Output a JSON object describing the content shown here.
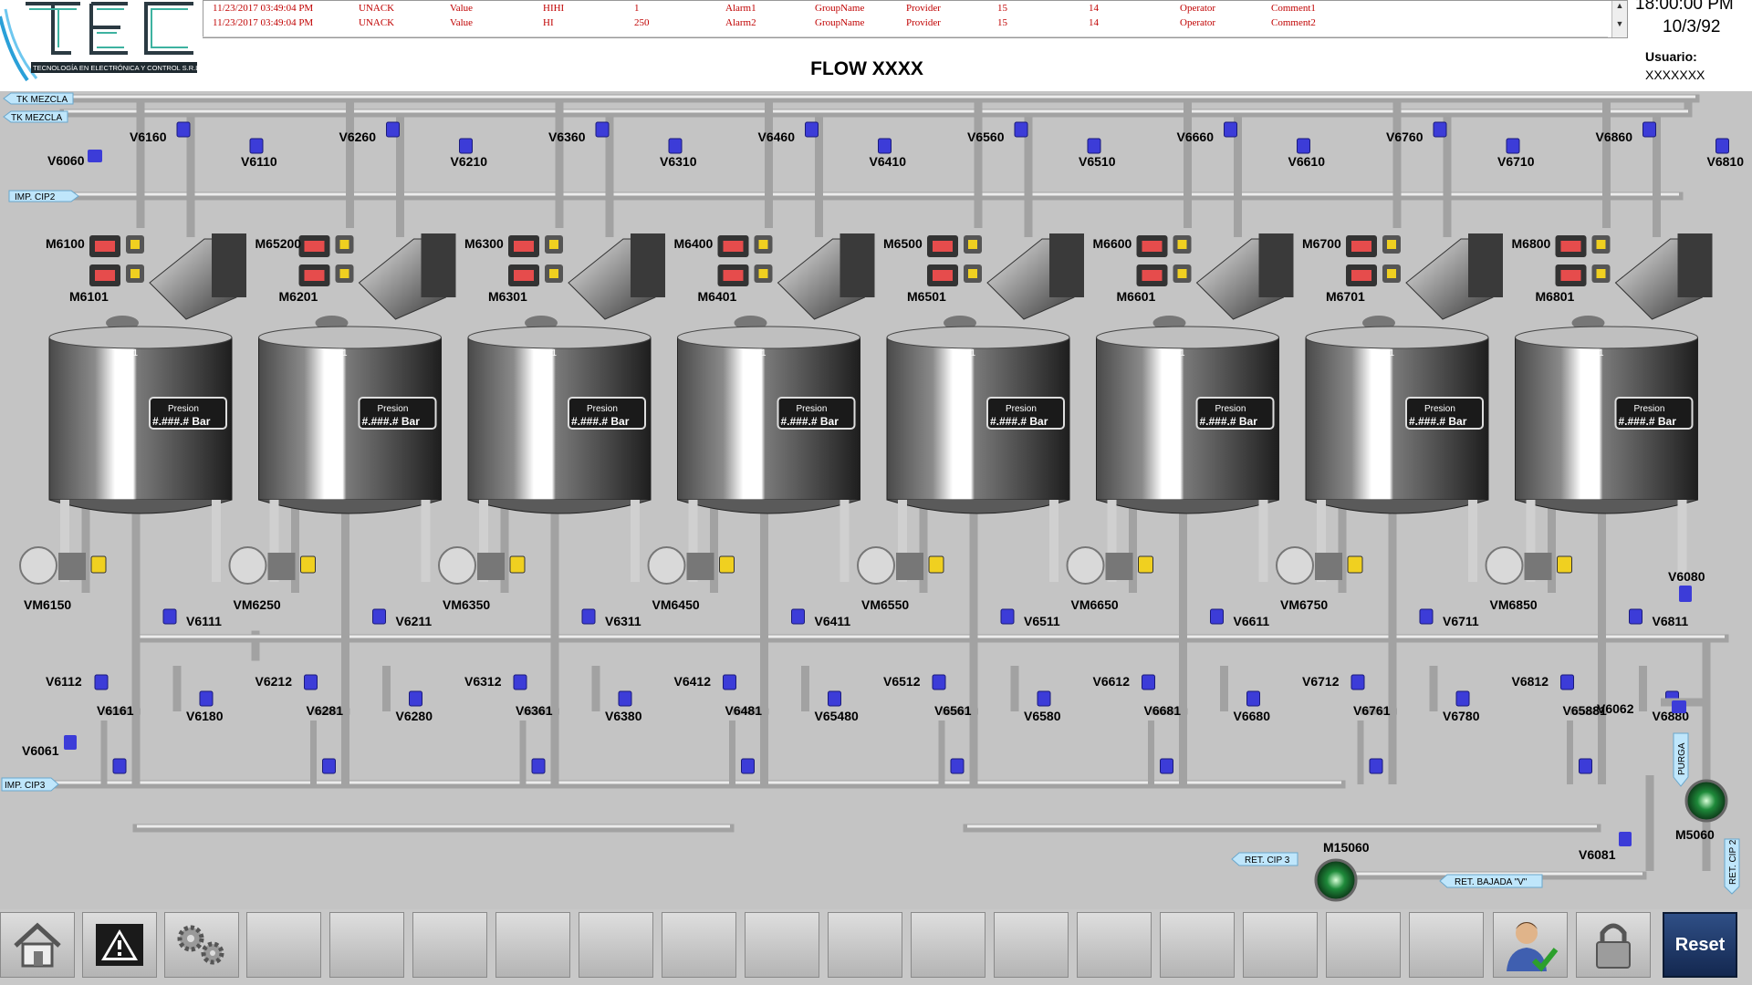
{
  "logo": {
    "text": "TEC",
    "tagline": "TECNOLOGÍA EN ELECTRÓNICA Y CONTROL S.R.L"
  },
  "alarms": [
    {
      "time": "11/23/2017 03:49:04 PM",
      "state": "UNACK",
      "type": "Value",
      "level": "HIHI",
      "value": "1",
      "name": "Alarm1",
      "group": "GroupName",
      "provider": "Provider",
      "p1": "15",
      "p2": "14",
      "operator": "Operator",
      "comment": "Comment1"
    },
    {
      "time": "11/23/2017 03:49:04 PM",
      "state": "UNACK",
      "type": "Value",
      "level": "HI",
      "value": "250",
      "name": "Alarm2",
      "group": "GroupName",
      "provider": "Provider",
      "p1": "15",
      "p2": "14",
      "operator": "Operator",
      "comment": "Comment2"
    }
  ],
  "title": "FLOW XXXX",
  "clock": {
    "time": "18:00:00 PM",
    "date": "10/3/92"
  },
  "user": {
    "label": "Usuario:",
    "value": "XXXXXXX"
  },
  "lines": {
    "tk_mezcla_1": "TK MEZCLA",
    "tk_mezcla_2": "TK MEZCLA",
    "imp_cip2": "IMP. CIP2",
    "imp_cip3": "IMP. CIP3",
    "ret_cip3": "RET. CIP 3",
    "ret_bajada": "RET. BAJADA \"V\"",
    "purga": "PURGA",
    "ret_cip2": "RET. CIP 2"
  },
  "tanks": [
    {
      "sc": "SC01",
      "pres_label": "Presion",
      "pres_value": "#.###.# Bar",
      "top_valve": "V6160",
      "side_valve": "V6110",
      "motor_top": "M6100",
      "motor_bot": "M6101",
      "pump": "VM6150",
      "out_valve": "V6111",
      "low_valve": "V6112",
      "drain_valve": "V6180",
      "bot_valve": "V6161"
    },
    {
      "sc": "SC01",
      "pres_label": "Presion",
      "pres_value": "#.###.# Bar",
      "top_valve": "V6260",
      "side_valve": "V6210",
      "motor_top": "M65200",
      "motor_bot": "M6201",
      "pump": "VM6250",
      "out_valve": "V6211",
      "low_valve": "V6212",
      "drain_valve": "V6280",
      "bot_valve": "V6281"
    },
    {
      "sc": "SC01",
      "pres_label": "Presion",
      "pres_value": "#.###.# Bar",
      "top_valve": "V6360",
      "side_valve": "V6310",
      "motor_top": "M6300",
      "motor_bot": "M6301",
      "pump": "VM6350",
      "out_valve": "V6311",
      "low_valve": "V6312",
      "drain_valve": "V6380",
      "bot_valve": "V6361"
    },
    {
      "sc": "SC01",
      "pres_label": "Presion",
      "pres_value": "#.###.# Bar",
      "top_valve": "V6460",
      "side_valve": "V6410",
      "motor_top": "M6400",
      "motor_bot": "M6401",
      "pump": "VM6450",
      "out_valve": "V6411",
      "low_valve": "V6412",
      "drain_valve": "V65480",
      "bot_valve": "V6481"
    },
    {
      "sc": "SC01",
      "pres_label": "Presion",
      "pres_value": "#.###.# Bar",
      "top_valve": "V6560",
      "side_valve": "V6510",
      "motor_top": "M6500",
      "motor_bot": "M6501",
      "pump": "VM6550",
      "out_valve": "V6511",
      "low_valve": "V6512",
      "drain_valve": "V6580",
      "bot_valve": "V6561"
    },
    {
      "sc": "SC01",
      "pres_label": "Presion",
      "pres_value": "#.###.# Bar",
      "top_valve": "V6660",
      "side_valve": "V6610",
      "motor_top": "M6600",
      "motor_bot": "M6601",
      "pump": "VM6650",
      "out_valve": "V6611",
      "low_valve": "V6612",
      "drain_valve": "V6680",
      "bot_valve": "V6681"
    },
    {
      "sc": "SC01",
      "pres_label": "Presion",
      "pres_value": "#.###.# Bar",
      "top_valve": "V6760",
      "side_valve": "V6710",
      "motor_top": "M6700",
      "motor_bot": "M6701",
      "pump": "VM6750",
      "out_valve": "V6711",
      "low_valve": "V6712",
      "drain_valve": "V6780",
      "bot_valve": "V6761"
    },
    {
      "sc": "SC01",
      "pres_label": "Presion",
      "pres_value": "#.###.# Bar",
      "top_valve": "V6860",
      "side_valve": "V6810",
      "motor_top": "M6800",
      "motor_bot": "M6801",
      "pump": "VM6850",
      "out_valve": "V6811",
      "low_valve": "V6812",
      "drain_valve": "V6880",
      "bot_valve": "V65881"
    }
  ],
  "extra_tags": {
    "v6060": "V6060",
    "v6061": "V6061",
    "v6062": "V6062",
    "v6080": "V6080",
    "v6081": "V6081",
    "m5060": "M5060",
    "m15060": "M15060"
  },
  "toolbar": {
    "reset": "Reset",
    "icons": [
      "home-icon",
      "alarm-warning-icon",
      "gears-icon",
      "user-check-icon",
      "lock-icon"
    ]
  }
}
